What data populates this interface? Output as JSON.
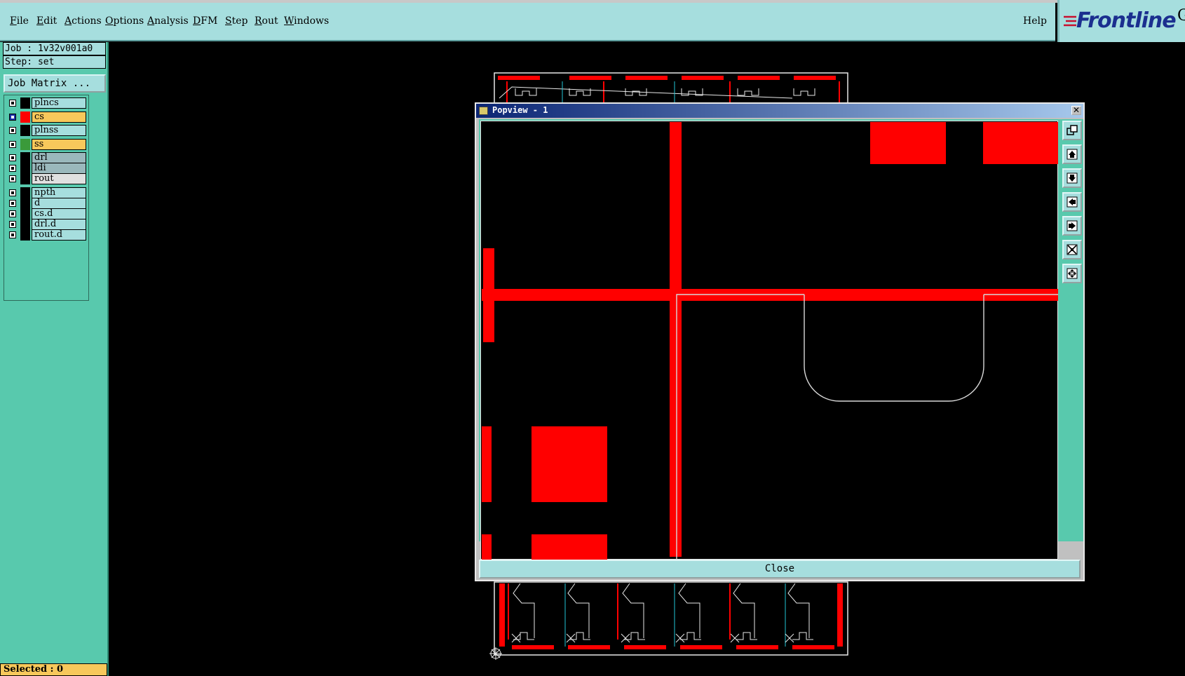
{
  "menubar": {
    "items": [
      {
        "label": "File"
      },
      {
        "label": "Edit"
      },
      {
        "label": "Actions"
      },
      {
        "label": "Options"
      },
      {
        "label": "Analysis"
      },
      {
        "label": "DFM"
      },
      {
        "label": "Step"
      },
      {
        "label": "Rout"
      },
      {
        "label": "Windows"
      }
    ],
    "help_label": "Help"
  },
  "logo": {
    "text": "Frontline",
    "suffix": "G"
  },
  "job": {
    "job_line": "Job : 1v32v001a0",
    "step_line": "Step: set",
    "job_matrix_label": "Job Matrix ..."
  },
  "layers": [
    {
      "name": "plncs",
      "color": "#000000",
      "highlight": "#a6dede",
      "active": false
    },
    {
      "name": "cs",
      "color": "#ff0000",
      "highlight": "#f7c85b",
      "active": true
    },
    {
      "name": "plnss",
      "color": "#000000",
      "highlight": "#a6dede",
      "active": false
    },
    {
      "name": "ss",
      "color": "#3a9a3a",
      "highlight": "#f7c85b",
      "active": false
    },
    {
      "name": "drl",
      "color": "#000000",
      "highlight": "#9ab8bc",
      "active": false
    },
    {
      "name": "ldi",
      "color": "#000000",
      "highlight": "#9ab8bc",
      "active": false
    },
    {
      "name": "rout",
      "color": "#000000",
      "highlight": "#e0e0e0",
      "active": false
    },
    {
      "name": "npth",
      "color": "#000000",
      "highlight": "#a6dede",
      "active": false
    },
    {
      "name": "d",
      "color": "#000000",
      "highlight": "#a6dede",
      "active": false
    },
    {
      "name": "cs.d",
      "color": "#000000",
      "highlight": "#a6dede",
      "active": false
    },
    {
      "name": "drl.d",
      "color": "#000000",
      "highlight": "#a6dede",
      "active": false
    },
    {
      "name": "rout.d",
      "color": "#000000",
      "highlight": "#a6dede",
      "active": false
    }
  ],
  "status": {
    "selected": "Selected : 0"
  },
  "popview": {
    "title": "Popview - 1",
    "close_label": "Close",
    "toolbar_icons": [
      "zoom-window-icon",
      "pan-up-icon",
      "pan-down-icon",
      "pan-left-icon",
      "pan-right-icon",
      "zoom-fit-icon",
      "zoom-home-icon"
    ]
  },
  "colors": {
    "panel": "#58c9ad",
    "menubar": "#a6dede",
    "copper": "#ff0000",
    "rout": "#e8e8e8",
    "highlight": "#f7c85b"
  }
}
